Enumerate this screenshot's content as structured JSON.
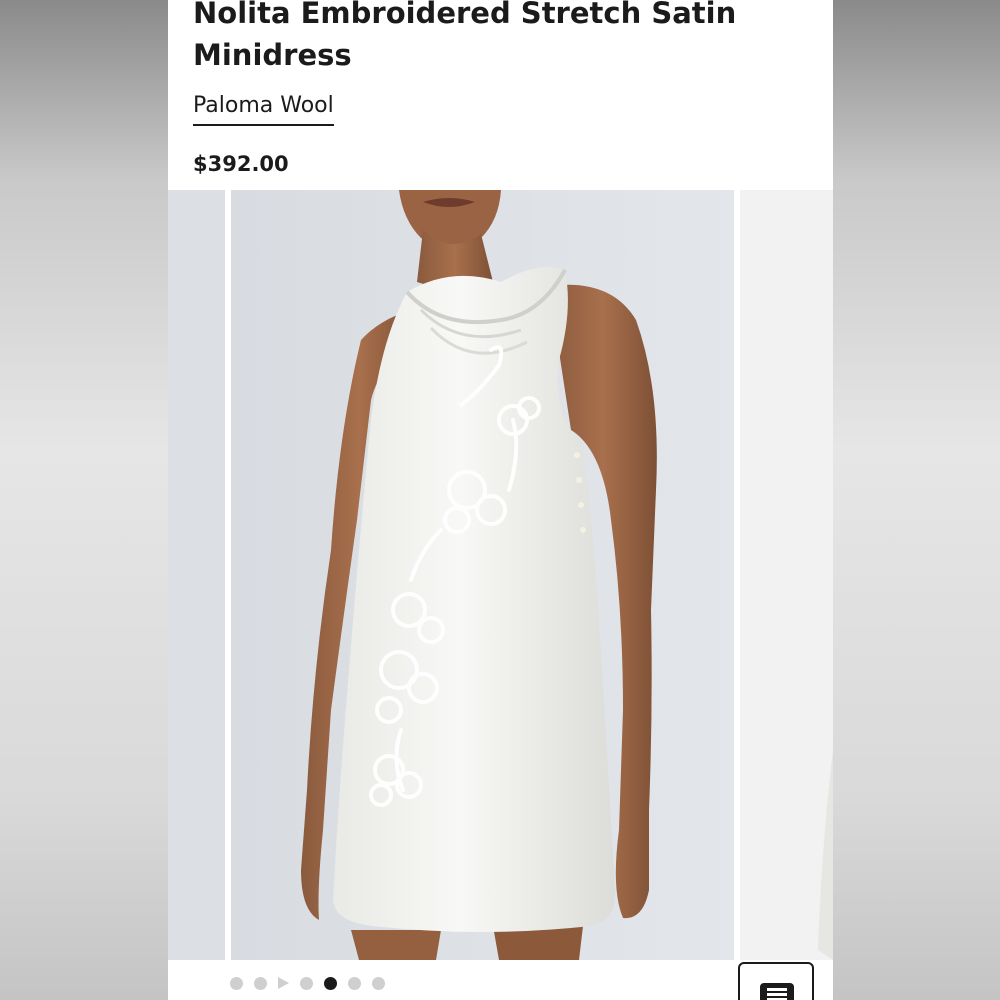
{
  "product": {
    "title": "Nolita Embroidered Stretch Satin Minidress",
    "brand": "Paloma Wool",
    "price": "$392.00"
  },
  "gallery": {
    "image_alt": "Model wearing white cowl-neck satin minidress with floral embroidery",
    "active_index": 5,
    "indicators": [
      "dot",
      "dot",
      "play",
      "dot",
      "dot",
      "dot",
      "dot"
    ]
  },
  "icons": {
    "menu": "menu-icon"
  },
  "colors": {
    "text": "#1b1b1b",
    "dot_inactive": "#cfcfcf",
    "dot_active": "#1b1b1b"
  }
}
